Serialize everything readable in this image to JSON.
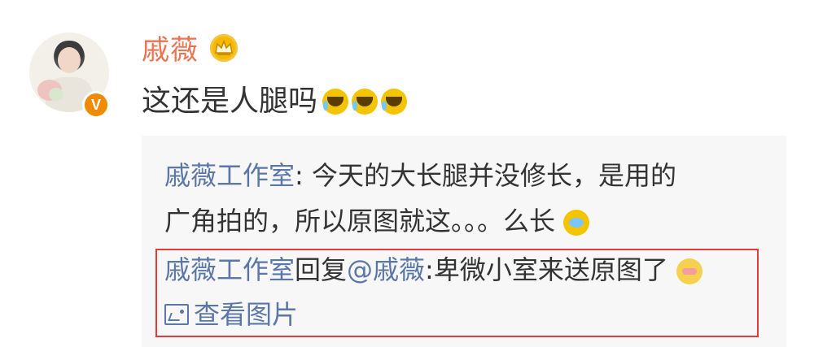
{
  "user": {
    "name": "戚薇",
    "comment": "这还是人腿吗"
  },
  "icons": {
    "verified": "verified-badge-icon",
    "crown": "crown-icon",
    "laugh": "laughing-tears-emoji",
    "cry": "crying-face-emoji",
    "shy": "shy-face-emoji",
    "image": "image-icon"
  },
  "reply": {
    "line1_author": "戚薇工作室",
    "line1_text": ": 今天的大长腿并没修长，是用的",
    "line2_text": "广角拍的，所以原图就这。。。么长",
    "reply_author": "戚薇工作室",
    "reply_label": "回复",
    "mention": "@戚薇",
    "reply_text": ":卑微小室来送原图了",
    "image_link": "查看图片"
  },
  "colors": {
    "username": "#eb7350",
    "link": "#5b77a8",
    "highlight_border": "#e53a3a",
    "reply_background": "#f7f7f7",
    "verified_badge": "#f08a00"
  }
}
